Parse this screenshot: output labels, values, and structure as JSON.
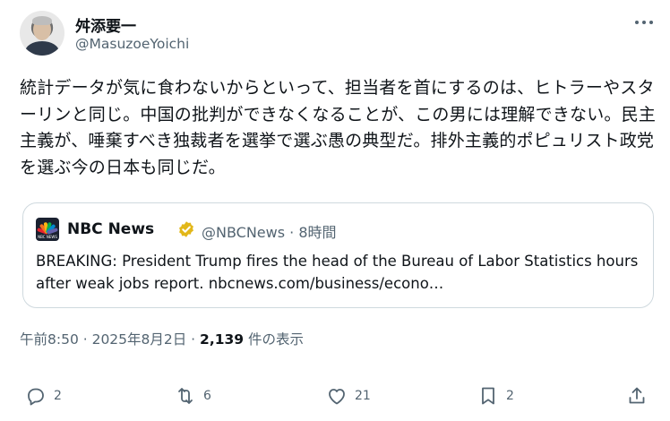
{
  "author": {
    "display_name": "舛添要一",
    "handle": "@MasuzoeYoichi"
  },
  "tweet": {
    "text": "統計データが気に食わないからといって、担当者を首にするのは、ヒトラーやスターリンと同じ。中国の批判ができなくなることが、この男には理解できない。民主主義が、唾棄すべき独裁者を選挙で選ぶ愚の典型だ。排外主義的ポピュリスト政党を選ぶ今の日本も同じだ。"
  },
  "quote": {
    "name": "NBC News",
    "handle_time": "@NBCNews · 8時間",
    "text": "BREAKING: President Trump fires the head of the Bureau of Labor Statistics hours after weak jobs report. nbcnews.com/business/econo…",
    "logo_caption": "NBC NEWS",
    "badge_color": "#e2b719"
  },
  "meta": {
    "time_date": "午前8:50 · 2025年8月2日 · ",
    "views_count": "2,139",
    "views_label": " 件の表示"
  },
  "actions": {
    "replies": "2",
    "reposts": "6",
    "likes": "21",
    "bookmarks": "2"
  },
  "colors": {
    "text_primary": "#0f1419",
    "text_secondary": "#536471",
    "border": "#cfd9de"
  }
}
